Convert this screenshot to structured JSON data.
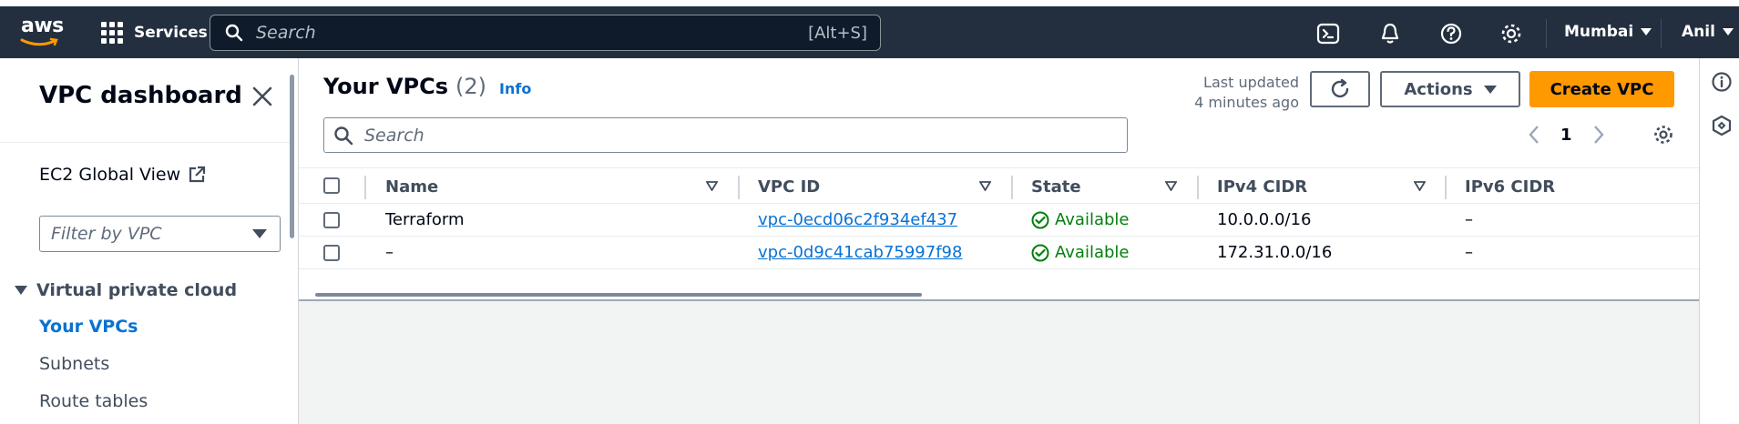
{
  "topnav": {
    "logo_text": "aws",
    "services_label": "Services",
    "search_placeholder": "Search",
    "search_shortcut": "[Alt+S]",
    "region": "Mumbai",
    "user": "Anil",
    "icons": [
      "cloudshell-icon",
      "bell-icon",
      "help-icon",
      "settings-icon"
    ]
  },
  "sidebar": {
    "title": "VPC dashboard",
    "ec2_global_view": "EC2 Global View",
    "filter_placeholder": "Filter by VPC",
    "section_title": "Virtual private cloud",
    "items": [
      {
        "label": "Your VPCs",
        "active": true
      },
      {
        "label": "Subnets",
        "active": false
      },
      {
        "label": "Route tables",
        "active": false
      }
    ]
  },
  "panel": {
    "title": "Your VPCs",
    "count": "(2)",
    "info_label": "Info",
    "last_updated_line1": "Last updated",
    "last_updated_line2": "4 minutes ago",
    "actions_label": "Actions",
    "create_label": "Create VPC",
    "search_placeholder": "Search",
    "page_number": "1"
  },
  "table": {
    "columns": [
      "Name",
      "VPC ID",
      "State",
      "IPv4 CIDR",
      "IPv6 CIDR"
    ],
    "rows": [
      {
        "name": "Terraform",
        "vpc_id": "vpc-0ecd06c2f934ef437",
        "state": "Available",
        "ipv4": "10.0.0.0/16",
        "ipv6": "–"
      },
      {
        "name": "–",
        "vpc_id": "vpc-0d9c41cab75997f98",
        "state": "Available",
        "ipv4": "172.31.0.0/16",
        "ipv6": "–"
      }
    ]
  },
  "colors": {
    "nav_bg": "#232f3e",
    "accent_link": "#0972d3",
    "primary_button": "#ff9900",
    "success": "#037f0c"
  }
}
